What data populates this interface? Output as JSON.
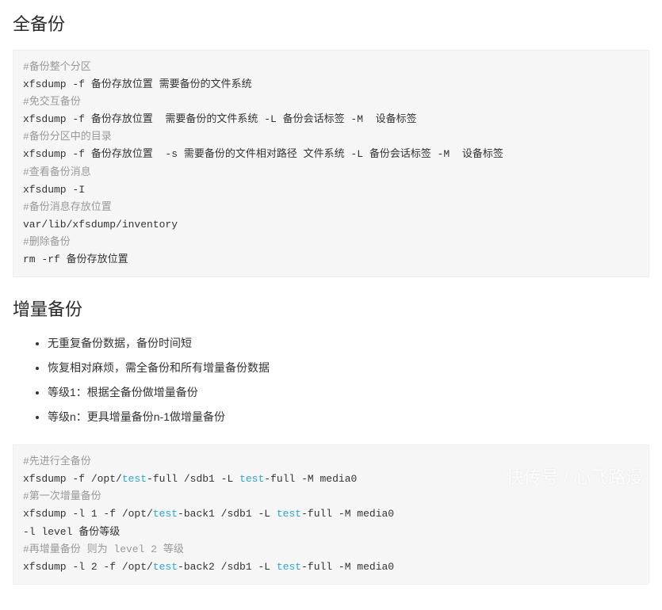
{
  "section1": {
    "title": "全备份"
  },
  "code1": {
    "c1": "#备份整个分区",
    "l1": "xfsdump -f 备份存放位置 需要备份的文件系统",
    "c2": "#免交互备份",
    "l2": "xfsdump -f 备份存放位置  需要备份的文件系统 -L 备份会话标签 -M  设备标签",
    "c3": "#备份分区中的目录",
    "l3": "xfsdump -f 备份存放位置  -s 需要备份的文件相对路径 文件系统 -L 备份会话标签 -M  设备标签",
    "c4": "#查看备份消息",
    "l4": "xfsdump -I",
    "c5": "#备份消息存放位置",
    "l5": "var/lib/xfsdump/inventory",
    "c6": "#删除备份",
    "l6": "rm -rf 备份存放位置"
  },
  "section2": {
    "title": "增量备份"
  },
  "bullets": [
    "无重复备份数据，备份时间短",
    "恢复相对麻烦，需全备份和所有增量备份数据",
    "等级1：根据全备份做增量备份",
    "等级n：更具增量备份n-1做增量备份"
  ],
  "code2": {
    "c1": "#先进行全备份",
    "l1a": "xfsdump -f /opt/",
    "l1b": "test",
    "l1c": "-full /sdb1 -L ",
    "l1d": "test",
    "l1e": "-full -M media0",
    "c2": "#第一次增量备份",
    "l2a": "xfsdump -l 1 -f /opt/",
    "l2b": "test",
    "l2c": "-back1 /sdb1 -L ",
    "l2d": "test",
    "l2e": "-full -M media0",
    "l3": "-l level 备份等级",
    "c3": "#再增量备份 则为 level 2 等级",
    "l4a": "xfsdump -l 2 -f /opt/",
    "l4b": "test",
    "l4c": "-back2 /sdb1 -L ",
    "l4d": "test",
    "l4e": "-full -M media0"
  },
  "watermark": "快传号 / 心飞路漫"
}
